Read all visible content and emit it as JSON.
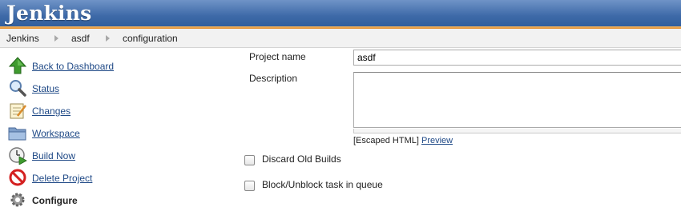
{
  "header": {
    "logo_text": "Jenkins"
  },
  "breadcrumb": {
    "items": [
      "Jenkins",
      "asdf",
      "configuration"
    ]
  },
  "sidebar": {
    "items": [
      {
        "label": "Back to Dashboard",
        "icon": "up-arrow-icon"
      },
      {
        "label": "Status",
        "icon": "magnifier-icon"
      },
      {
        "label": "Changes",
        "icon": "notepad-icon"
      },
      {
        "label": "Workspace",
        "icon": "folder-icon"
      },
      {
        "label": "Build Now",
        "icon": "clock-play-icon"
      },
      {
        "label": "Delete Project",
        "icon": "no-entry-icon"
      },
      {
        "label": "Configure",
        "icon": "gear-icon"
      }
    ]
  },
  "form": {
    "project_name_label": "Project name",
    "project_name_value": "asdf",
    "description_label": "Description",
    "escaped_html_text": "[Escaped HTML]",
    "preview_link": "Preview",
    "discard_old_builds_label": "Discard Old Builds",
    "block_unblock_label": "Block/Unblock task in queue"
  },
  "colors": {
    "header_blue": "#3e6aa8",
    "header_stripe": "#e48c2c",
    "link": "#204a87"
  }
}
